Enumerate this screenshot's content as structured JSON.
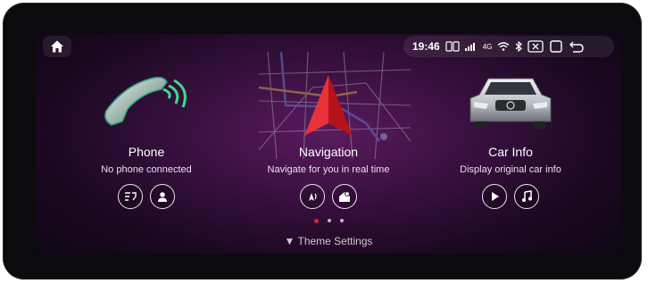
{
  "statusbar": {
    "time": "19:46",
    "network": "4G",
    "icons": [
      "sim-icon",
      "signal-icon",
      "wifi-icon",
      "bluetooth-icon",
      "close-app-icon",
      "recent-apps-icon",
      "back-icon"
    ]
  },
  "apps": [
    {
      "title": "Phone",
      "subtitle": "No phone connected",
      "buttons": [
        "call-log-icon",
        "contacts-icon"
      ]
    },
    {
      "title": "Navigation",
      "subtitle": "Navigate for you in real time",
      "buttons": [
        "voice-nav-icon",
        "map-location-icon"
      ]
    },
    {
      "title": "Car Info",
      "subtitle": "Display original car info",
      "buttons": [
        "play-icon",
        "music-icon"
      ]
    }
  ],
  "pager": {
    "pages": 3,
    "active": 0
  },
  "footer": {
    "theme_label": "Theme Settings"
  },
  "colors": {
    "accent": "#e0202a",
    "background": "#3a1040"
  }
}
